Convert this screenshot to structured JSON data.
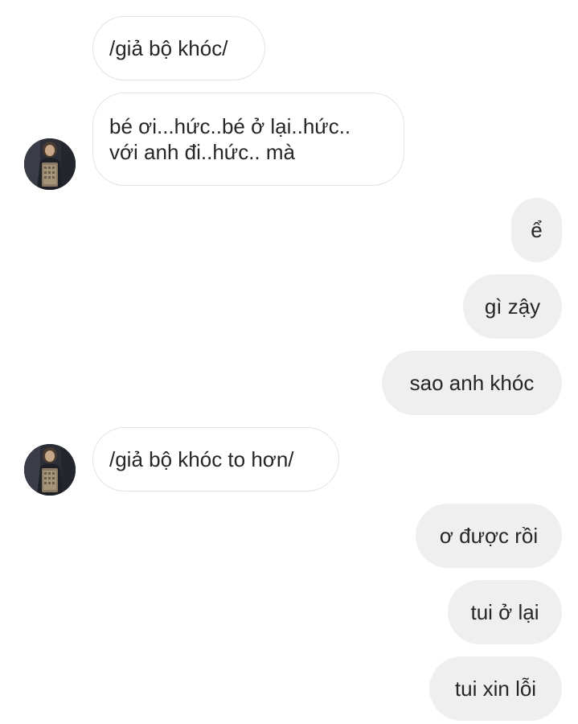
{
  "thread": {
    "messages": [
      {
        "sender": "other",
        "text": "/giả bộ khóc/"
      },
      {
        "sender": "other",
        "text_line1": "bé ơi...hức..bé ở lại..hức..",
        "text_line2": "với anh đi..hức.. mà"
      },
      {
        "sender": "me",
        "text": "ể"
      },
      {
        "sender": "me",
        "text": "gì zậy"
      },
      {
        "sender": "me",
        "text": "sao anh khóc"
      },
      {
        "sender": "other",
        "text": "/giả bộ khóc to hơn/"
      },
      {
        "sender": "me",
        "text": "ơ được rồi"
      },
      {
        "sender": "me",
        "text": "tui ở lại"
      },
      {
        "sender": "me",
        "text": "tui xin lỗi"
      }
    ]
  },
  "colors": {
    "incoming_bg": "#ffffff",
    "incoming_border": "#e3e3e3",
    "outgoing_bg": "#efefef",
    "text": "#262626"
  },
  "icons": {
    "avatar": "contact-avatar-photo"
  }
}
